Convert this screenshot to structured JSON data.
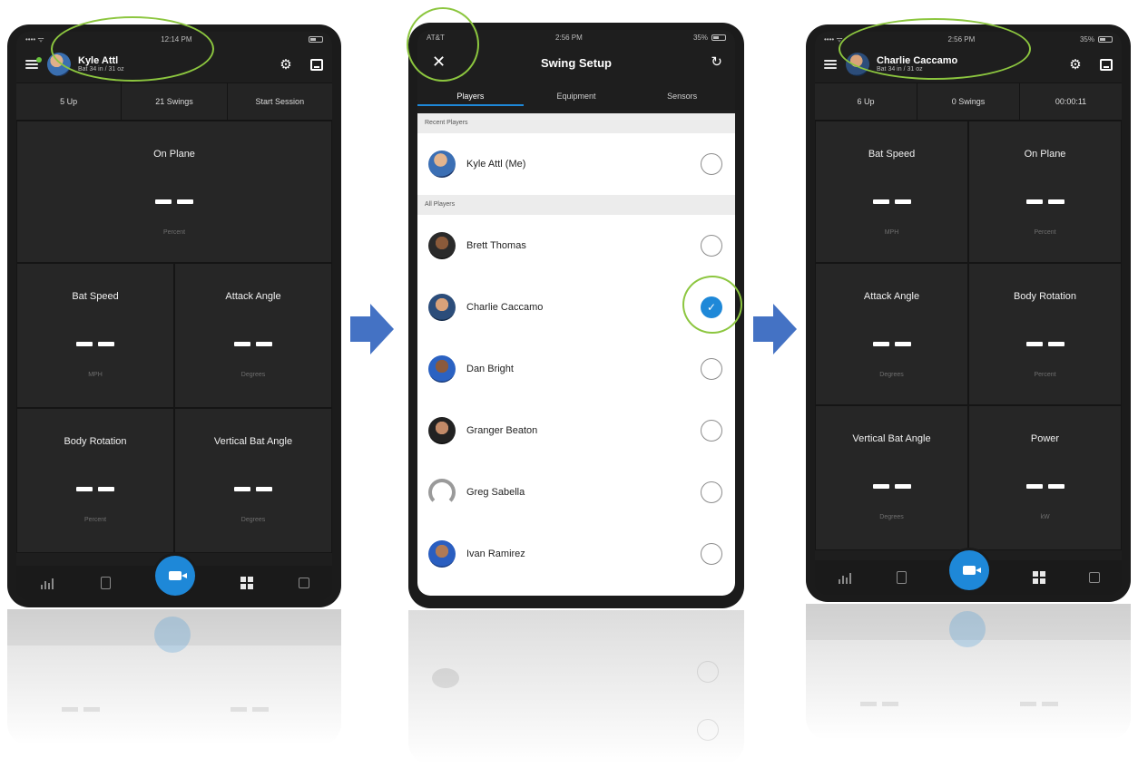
{
  "colors": {
    "accent": "#1e88d8",
    "highlight": "#8cc63f",
    "arrow": "#4472c4",
    "tile_bg": "#262626"
  },
  "left": {
    "user_name": "Kyle Attl",
    "user_sub": "Bat 34 in / 31 oz",
    "stats": [
      "5 Up",
      "21 Swings",
      "Start Session"
    ],
    "tiles": [
      {
        "label": "On Plane",
        "unit": "Percent"
      },
      {
        "label": "Bat Speed",
        "unit": "MPH"
      },
      {
        "label": "Attack Angle",
        "unit": "Degrees"
      },
      {
        "label": "Body Rotation",
        "unit": "Percent"
      },
      {
        "label": "Vertical Bat Angle",
        "unit": "Degrees"
      }
    ],
    "nav_icons": [
      "chart-icon",
      "clipboard-icon",
      "video-icon",
      "grid-icon",
      "gallery-icon"
    ]
  },
  "middle": {
    "status": {
      "carrier": "AT&T",
      "time": "2:56 PM",
      "battery": "35%"
    },
    "title": "Swing Setup",
    "tabs": [
      "Players",
      "Equipment",
      "Sensors"
    ],
    "recent_header": "Recent Players",
    "recent": [
      {
        "name": "Kyle Attl (Me)",
        "selected": false
      }
    ],
    "all_header": "All Players",
    "players": [
      {
        "name": "Brett Thomas",
        "selected": false
      },
      {
        "name": "Charlie Caccamo",
        "selected": true
      },
      {
        "name": "Dan Bright",
        "selected": false
      },
      {
        "name": "Granger Beaton",
        "selected": false
      },
      {
        "name": "Greg Sabella",
        "selected": false
      },
      {
        "name": "Ivan Ramirez",
        "selected": false
      }
    ]
  },
  "right": {
    "status": {
      "time": "2:56 PM",
      "battery": "35%"
    },
    "user_name": "Charlie Caccamo",
    "user_sub": "Bat 34 in / 31 oz",
    "stats": [
      "6 Up",
      "0 Swings",
      "00:00:11"
    ],
    "tiles": [
      {
        "label": "Bat Speed",
        "unit": "MPH"
      },
      {
        "label": "On Plane",
        "unit": "Percent"
      },
      {
        "label": "Attack Angle",
        "unit": "Degrees"
      },
      {
        "label": "Body Rotation",
        "unit": "Percent"
      },
      {
        "label": "Vertical Bat Angle",
        "unit": "Degrees"
      },
      {
        "label": "Power",
        "unit": "kW"
      }
    ]
  }
}
